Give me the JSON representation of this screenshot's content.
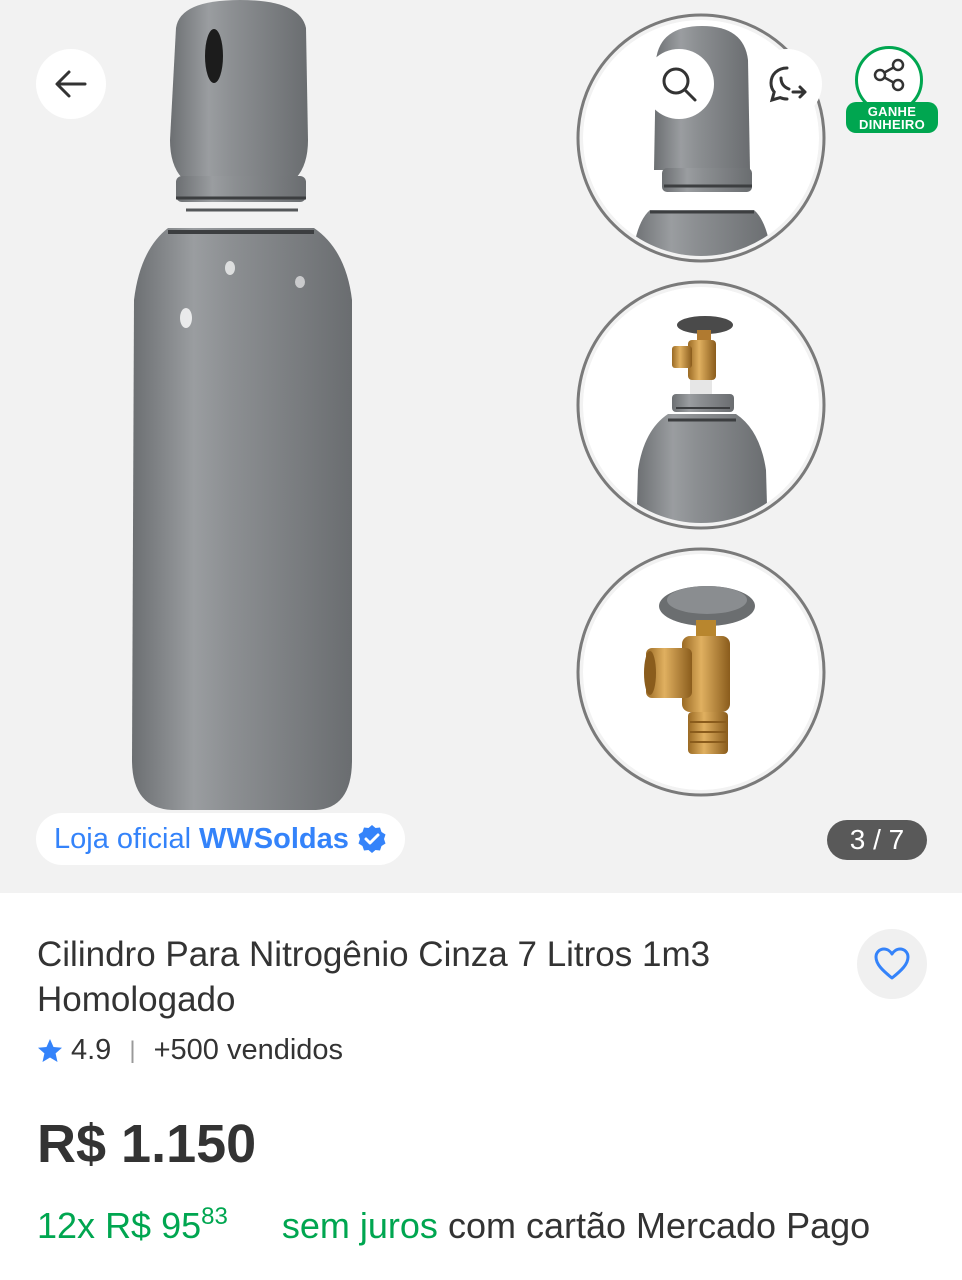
{
  "gallery": {
    "counter": "3 / 7",
    "store_prefix": "Loja oficial",
    "store_name": "WWSoldas",
    "share_badge_line1": "GANHE",
    "share_badge_line2": "DINHEIRO"
  },
  "product": {
    "title": "Cilindro Para Nitrogênio Cinza 7 Litros 1m3 Homologado",
    "rating": "4.9",
    "sold": "+500 vendidos",
    "price": "R$ 1.150",
    "installments_count": "12x",
    "installment_currency": "R$",
    "installment_whole": "95",
    "installment_cents": "83",
    "no_interest": "sem juros",
    "payment_method": "com cartão Mercado Pago"
  },
  "colors": {
    "brand_blue": "#3483fa",
    "green": "#00a650",
    "cylinder_gray": "#8a8d90"
  },
  "icons": [
    "back-arrow-icon",
    "search-icon",
    "whatsapp-icon",
    "share-icon",
    "verified-icon",
    "heart-icon",
    "star-icon"
  ]
}
